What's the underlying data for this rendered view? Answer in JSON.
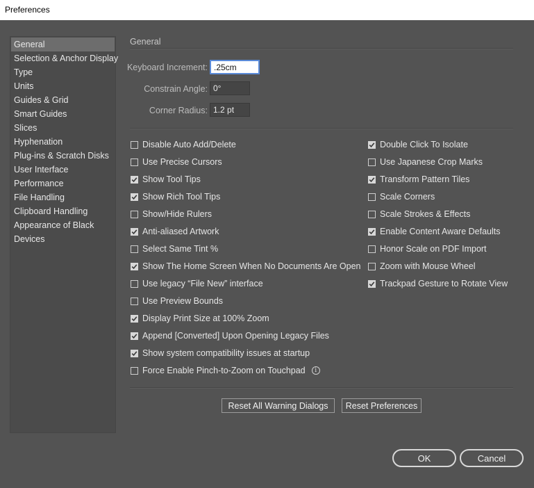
{
  "window": {
    "title": "Preferences"
  },
  "sidebar": {
    "items": [
      {
        "label": "General",
        "selected": true
      },
      {
        "label": "Selection & Anchor Display"
      },
      {
        "label": "Type"
      },
      {
        "label": "Units"
      },
      {
        "label": "Guides & Grid"
      },
      {
        "label": "Smart Guides"
      },
      {
        "label": "Slices"
      },
      {
        "label": "Hyphenation"
      },
      {
        "label": "Plug-ins & Scratch Disks"
      },
      {
        "label": "User Interface"
      },
      {
        "label": "Performance"
      },
      {
        "label": "File Handling"
      },
      {
        "label": "Clipboard Handling"
      },
      {
        "label": "Appearance of Black"
      },
      {
        "label": "Devices"
      }
    ]
  },
  "general": {
    "title": "General",
    "keyboard_increment": {
      "label": "Keyboard Increment:",
      "value": ".25cm"
    },
    "constrain_angle": {
      "label": "Constrain Angle:",
      "value": "0°"
    },
    "corner_radius": {
      "label": "Corner Radius:",
      "value": "1.2 pt"
    },
    "left_options": [
      {
        "label": "Disable Auto Add/Delete",
        "checked": false
      },
      {
        "label": "Use Precise Cursors",
        "checked": false
      },
      {
        "label": "Show Tool Tips",
        "checked": true
      },
      {
        "label": "Show Rich Tool Tips",
        "checked": true
      },
      {
        "label": "Show/Hide Rulers",
        "checked": false
      },
      {
        "label": "Anti-aliased Artwork",
        "checked": true
      },
      {
        "label": "Select Same Tint %",
        "checked": false
      },
      {
        "label": "Show The Home Screen When No Documents Are Open",
        "checked": true
      },
      {
        "label": "Use legacy “File New” interface",
        "checked": false
      },
      {
        "label": "Use Preview Bounds",
        "checked": false
      },
      {
        "label": "Display Print Size at 100% Zoom",
        "checked": true
      },
      {
        "label": "Append [Converted] Upon Opening Legacy Files",
        "checked": true
      },
      {
        "label": "Show system compatibility issues at startup",
        "checked": true
      },
      {
        "label": "Force Enable Pinch-to-Zoom on Touchpad",
        "checked": false,
        "info_icon": "info-icon"
      }
    ],
    "right_options": [
      {
        "label": "Double Click To Isolate",
        "checked": true
      },
      {
        "label": "Use Japanese Crop Marks",
        "checked": false
      },
      {
        "label": "Transform Pattern Tiles",
        "checked": true
      },
      {
        "label": "Scale Corners",
        "checked": false
      },
      {
        "label": "Scale Strokes & Effects",
        "checked": false
      },
      {
        "label": "Enable Content Aware Defaults",
        "checked": true
      },
      {
        "label": "Honor Scale on PDF Import",
        "checked": false
      },
      {
        "label": "Zoom with Mouse Wheel",
        "checked": false
      },
      {
        "label": "Trackpad Gesture to Rotate View",
        "checked": true
      }
    ],
    "reset_warnings_label": "Reset All Warning Dialogs",
    "reset_prefs_label": "Reset Preferences"
  },
  "footer": {
    "ok_label": "OK",
    "cancel_label": "Cancel"
  },
  "colors": {
    "background": "#535353",
    "panel": "#4b4b4b",
    "selected": "#6d6d6d",
    "focus_ring": "#5a8ad8"
  }
}
